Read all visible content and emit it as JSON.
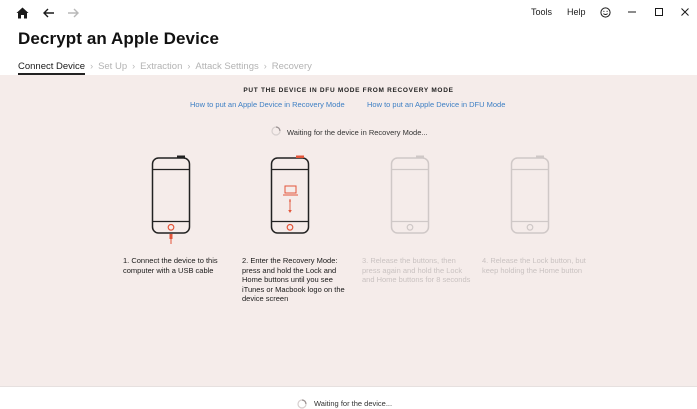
{
  "toolbar": {
    "tools_label": "Tools",
    "help_label": "Help"
  },
  "title": "Decrypt an Apple Device",
  "steps": [
    {
      "label": "Connect Device",
      "active": true
    },
    {
      "label": "Set Up",
      "active": false
    },
    {
      "label": "Extraction",
      "active": false
    },
    {
      "label": "Attack Settings",
      "active": false
    },
    {
      "label": "Recovery",
      "active": false
    }
  ],
  "instructions": {
    "heading": "PUT THE DEVICE IN DFU MODE FROM RECOVERY MODE",
    "link_recovery": "How to put an Apple Device in Recovery Mode",
    "link_dfu": "How to put an Apple Device in DFU Mode",
    "waiting": "Waiting for the device in Recovery Mode...",
    "cards": [
      {
        "text": "1. Connect the device to this computer with a USB cable"
      },
      {
        "text": "2. Enter the Recovery Mode: press and hold the Lock and Home buttons until you see iTunes or Macbook logo on the device screen"
      },
      {
        "text": "3. Release the buttons, then press again and hold the Lock and Home buttons for 8 seconds"
      },
      {
        "text": "4. Release the Lock button, but keep holding the Home button"
      }
    ]
  },
  "status": {
    "text": "Waiting for the device..."
  },
  "colors": {
    "accent_red": "#e2553a",
    "link": "#3d7fc4",
    "panel_bg": "#f5ecea"
  },
  "icons": [
    "home-icon",
    "back-arrow-icon",
    "forward-arrow-icon",
    "smiley-icon",
    "minimize-icon",
    "maximize-icon",
    "close-icon"
  ]
}
